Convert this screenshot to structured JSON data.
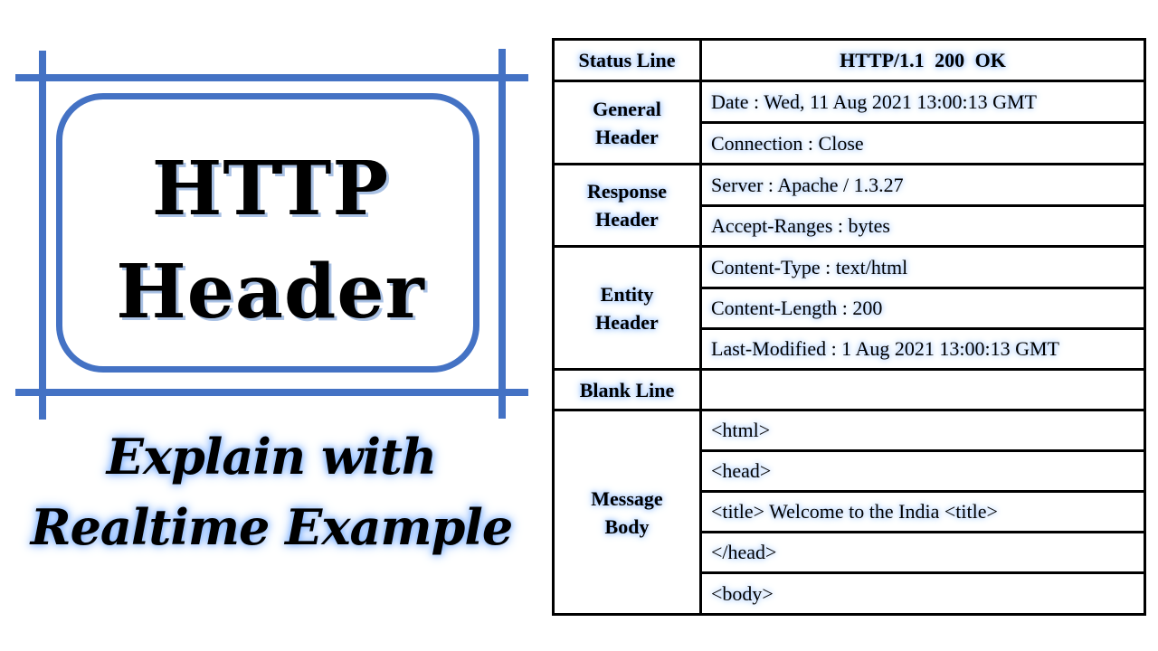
{
  "left_panel": {
    "title_line1": "HTTP",
    "title_line2": "Header",
    "subtitle_line1": "Explain with",
    "subtitle_line2": "Realtime Example",
    "frame_color": "#4472C4"
  },
  "table": {
    "status_line": {
      "label": "Status Line",
      "value": "HTTP/1.1  200  OK"
    },
    "sections": [
      {
        "label_line1": "General",
        "label_line2": "Header",
        "rows": [
          "Date : Wed, 11 Aug 2021 13:00:13 GMT",
          "Connection : Close"
        ]
      },
      {
        "label_line1": "Response",
        "label_line2": "Header",
        "rows": [
          "Server : Apache / 1.3.27",
          "Accept-Ranges : bytes"
        ]
      },
      {
        "label_line1": "Entity",
        "label_line2": "Header",
        "rows": [
          "Content-Type : text/html",
          "Content-Length : 200",
          "Last-Modified : 1 Aug 2021 13:00:13 GMT"
        ]
      }
    ],
    "blank_line": {
      "label": "Blank Line",
      "value": ""
    },
    "message_body": {
      "label_line1": "Message",
      "label_line2": "Body",
      "rows": [
        "<html>",
        "<head>",
        "<title> Welcome to the India <title>",
        "</head>",
        "<body>"
      ]
    }
  }
}
